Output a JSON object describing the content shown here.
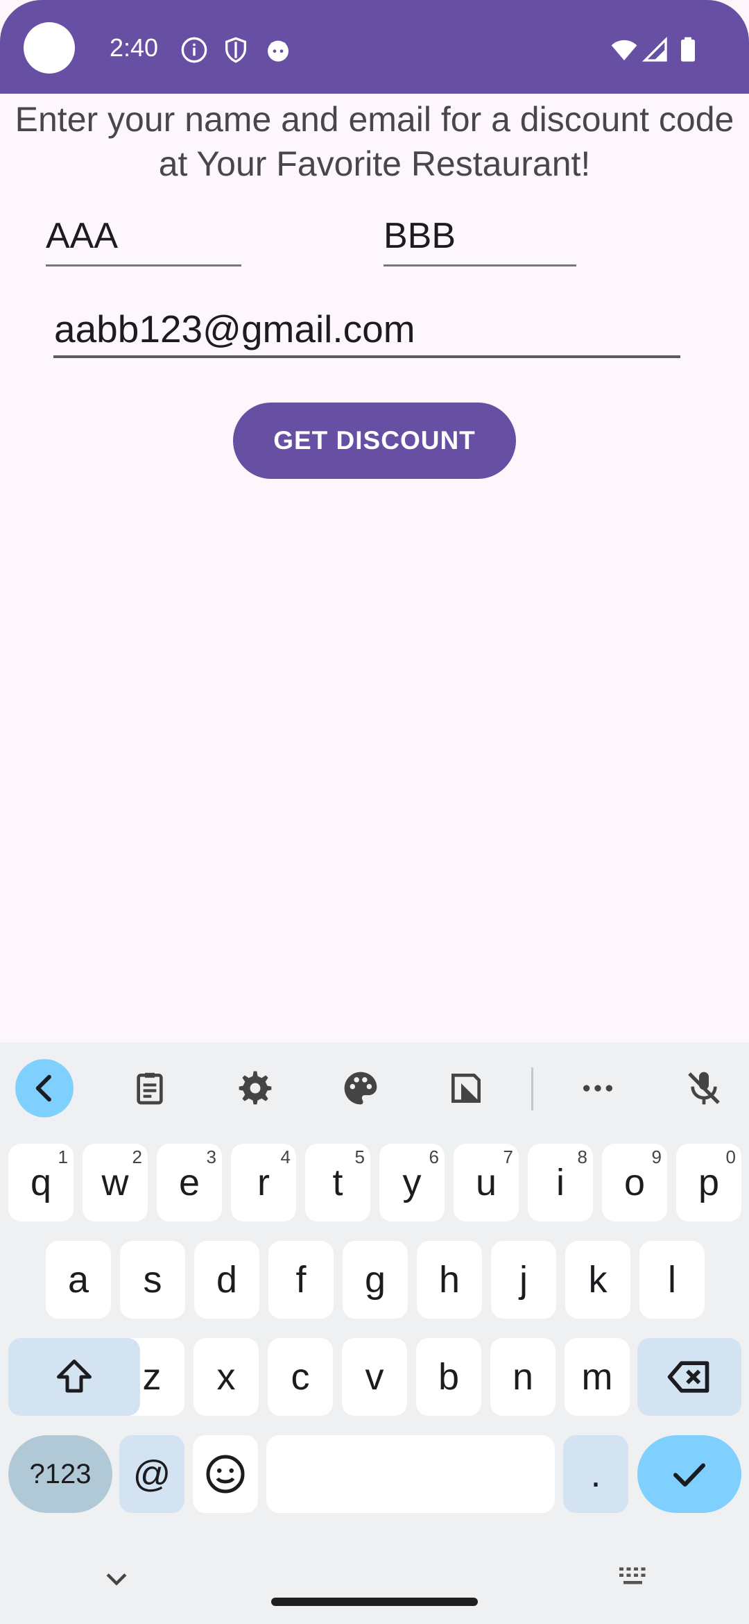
{
  "status_bar": {
    "time": "2:40",
    "icons_left": [
      "info-icon",
      "shield-icon",
      "android-face-icon"
    ],
    "icons_right": [
      "wifi-icon",
      "cellular-signal-icon",
      "battery-icon"
    ],
    "color": "#6750a4"
  },
  "form": {
    "prompt": "Enter your name and email for a discount code at Your Favorite Restaurant!",
    "first_name_value": "AAA",
    "last_name_value": "BBB",
    "email_value": "aabb123@gmail.com",
    "submit_label": "GET DISCOUNT"
  },
  "keyboard": {
    "toolbar": [
      "back-icon",
      "clipboard-icon",
      "gear-icon",
      "palette-icon",
      "crop-icon",
      "more-icon",
      "mic-off-icon"
    ],
    "row1": [
      {
        "k": "q",
        "h": "1"
      },
      {
        "k": "w",
        "h": "2"
      },
      {
        "k": "e",
        "h": "3"
      },
      {
        "k": "r",
        "h": "4"
      },
      {
        "k": "t",
        "h": "5"
      },
      {
        "k": "y",
        "h": "6"
      },
      {
        "k": "u",
        "h": "7"
      },
      {
        "k": "i",
        "h": "8"
      },
      {
        "k": "o",
        "h": "9"
      },
      {
        "k": "p",
        "h": "0"
      }
    ],
    "row2": [
      "a",
      "s",
      "d",
      "f",
      "g",
      "h",
      "j",
      "k",
      "l"
    ],
    "row3": [
      "z",
      "x",
      "c",
      "v",
      "b",
      "n",
      "m"
    ],
    "symbols_label": "?123",
    "at_label": "@",
    "period_label": ".",
    "accent_color": "#7fd0ff"
  }
}
